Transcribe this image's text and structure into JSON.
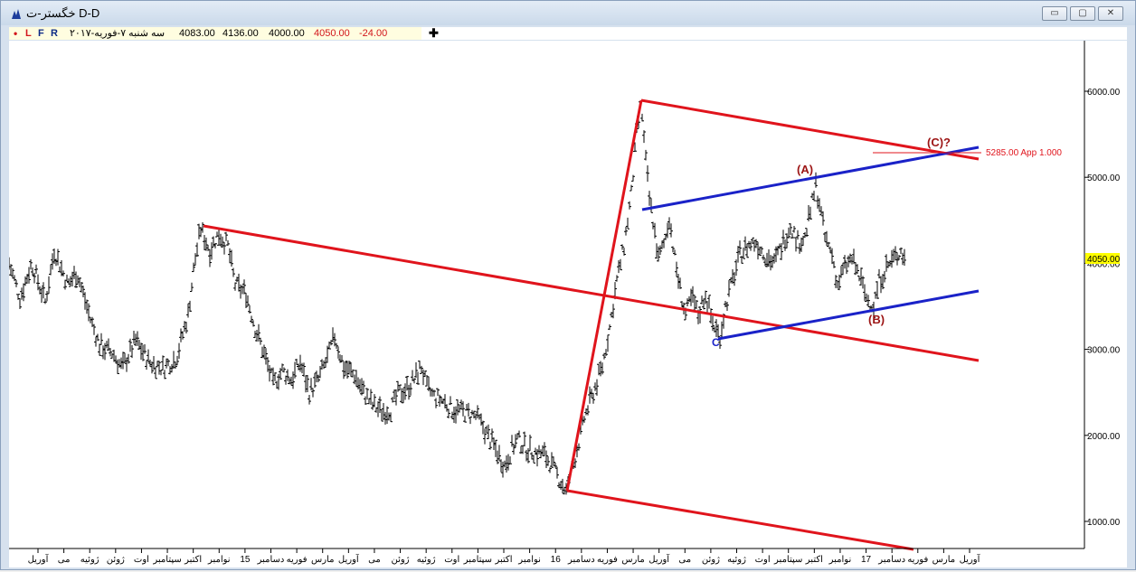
{
  "window": {
    "title": "خگستر-ت D-D",
    "icon": "chart-app-icon",
    "controls": {
      "minimize": "▭",
      "maximize": "▢",
      "close": "✕"
    }
  },
  "info_bar": {
    "flags": [
      "•",
      "L",
      "F",
      "R"
    ],
    "date": "سه شنبه ۷-فوریه-۲۰۱۷",
    "open": "4083.00",
    "high": "4136.00",
    "low": "4000.00",
    "close": "4050.00",
    "change": "-24.00",
    "add_button": "✚"
  },
  "chart_data": {
    "type": "ohlc",
    "y_axis": {
      "ticks": [
        "6000.00",
        "5000.00",
        "4000.00",
        "3000.00",
        "2000.00",
        "1000.00"
      ],
      "ylim": [
        700,
        6450
      ]
    },
    "current_price_label": "4050.00",
    "x_axis_labels": [
      "آوریل",
      "می",
      "ژوئیه",
      "ژوئن",
      "اوت",
      "سپتامبر",
      "اکتبر",
      "نوامبر",
      "15",
      "دسامبر",
      "فوریه",
      "مارس",
      "آوریل",
      "می",
      "ژوئن",
      "ژوئیه",
      "اوت",
      "سپتامبر",
      "اکتبر",
      "نوامبر",
      "16",
      "دسامبر",
      "فوریه",
      "مارس",
      "آوریل",
      "می",
      "ژوئن",
      "ژوئیه",
      "اوت",
      "سپتامبر",
      "اکتبر",
      "نوامبر",
      "17",
      "دسامبر",
      "فوریه",
      "مارس",
      "آوریل"
    ],
    "price_path": [
      [
        0,
        4000
      ],
      [
        12,
        3600
      ],
      [
        25,
        4000
      ],
      [
        40,
        3550
      ],
      [
        50,
        4150
      ],
      [
        65,
        3750
      ],
      [
        75,
        3900
      ],
      [
        90,
        3350
      ],
      [
        100,
        3050
      ],
      [
        115,
        2950
      ],
      [
        125,
        2780
      ],
      [
        140,
        3100
      ],
      [
        155,
        2850
      ],
      [
        170,
        2780
      ],
      [
        185,
        2900
      ],
      [
        198,
        3400
      ],
      [
        205,
        4000
      ],
      [
        212,
        4400
      ],
      [
        222,
        4150
      ],
      [
        232,
        4350
      ],
      [
        242,
        4200
      ],
      [
        250,
        3750
      ],
      [
        262,
        3650
      ],
      [
        272,
        3250
      ],
      [
        282,
        2950
      ],
      [
        292,
        2600
      ],
      [
        302,
        2750
      ],
      [
        312,
        2650
      ],
      [
        322,
        2850
      ],
      [
        332,
        2500
      ],
      [
        342,
        2650
      ],
      [
        352,
        2900
      ],
      [
        360,
        3150
      ],
      [
        370,
        2800
      ],
      [
        382,
        2700
      ],
      [
        392,
        2500
      ],
      [
        402,
        2350
      ],
      [
        412,
        2280
      ],
      [
        422,
        2300
      ],
      [
        430,
        2480
      ],
      [
        440,
        2550
      ],
      [
        448,
        2650
      ],
      [
        456,
        2800
      ],
      [
        462,
        2550
      ],
      [
        470,
        2450
      ],
      [
        480,
        2400
      ],
      [
        490,
        2300
      ],
      [
        500,
        2280
      ],
      [
        508,
        2250
      ],
      [
        516,
        2220
      ],
      [
        524,
        2100
      ],
      [
        532,
        1950
      ],
      [
        540,
        1800
      ],
      [
        548,
        1650
      ],
      [
        556,
        1850
      ],
      [
        562,
        1950
      ],
      [
        572,
        1850
      ],
      [
        582,
        1800
      ],
      [
        592,
        1780
      ],
      [
        600,
        1650
      ],
      [
        608,
        1500
      ],
      [
        616,
        1350
      ],
      [
        626,
        1750
      ],
      [
        636,
        2200
      ],
      [
        646,
        2500
      ],
      [
        656,
        2800
      ],
      [
        664,
        3250
      ],
      [
        672,
        3800
      ],
      [
        680,
        4200
      ],
      [
        688,
        4800
      ],
      [
        694,
        5500
      ],
      [
        699,
        5850
      ],
      [
        703,
        5300
      ],
      [
        708,
        4750
      ],
      [
        712,
        4500
      ],
      [
        718,
        4050
      ],
      [
        725,
        4250
      ],
      [
        730,
        4550
      ],
      [
        736,
        4050
      ],
      [
        742,
        3700
      ],
      [
        748,
        3400
      ],
      [
        755,
        3600
      ],
      [
        762,
        3400
      ],
      [
        770,
        3650
      ],
      [
        778,
        3300
      ],
      [
        786,
        3150
      ],
      [
        792,
        3500
      ],
      [
        800,
        3800
      ],
      [
        808,
        4100
      ],
      [
        816,
        4200
      ],
      [
        826,
        4250
      ],
      [
        836,
        4100
      ],
      [
        846,
        4000
      ],
      [
        856,
        4250
      ],
      [
        864,
        4450
      ],
      [
        872,
        4250
      ],
      [
        880,
        4300
      ],
      [
        888,
        4700
      ],
      [
        892,
        4900
      ],
      [
        896,
        4700
      ],
      [
        902,
        4300
      ],
      [
        910,
        4100
      ],
      [
        916,
        3750
      ],
      [
        924,
        3950
      ],
      [
        932,
        4050
      ],
      [
        940,
        3850
      ],
      [
        948,
        3600
      ],
      [
        956,
        3500
      ],
      [
        962,
        3800
      ],
      [
        970,
        3950
      ],
      [
        978,
        4050
      ],
      [
        986,
        4150
      ],
      [
        990,
        4050
      ]
    ],
    "annotations": {
      "wave_a": "(A)",
      "wave_b": "(B)",
      "wave_c": "(C)?",
      "point_c": "C",
      "target_label": "5285.00 App 1.000"
    },
    "colors": {
      "red_lines": "#e0141c",
      "blue_lines": "#1a22c8",
      "label_red": "#9c1414",
      "price_bars": "#000000",
      "price_tag_bg": "#ffff00"
    }
  }
}
